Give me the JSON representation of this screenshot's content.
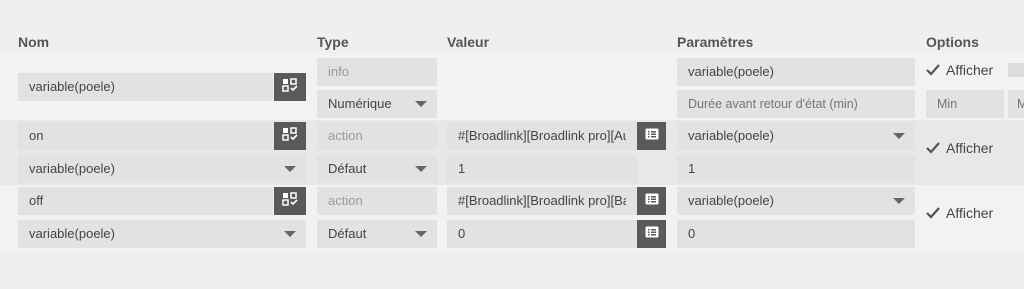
{
  "headers": {
    "nom": "Nom",
    "type": "Type",
    "valeur": "Valeur",
    "parametres": "Paramètres",
    "options": "Options"
  },
  "info_cmd": {
    "name": "variable(poele)",
    "type": "info",
    "subtype": "Numérique",
    "param_name": "variable(poele)",
    "return_delay_placeholder": "Durée avant retour d'état (min)",
    "min_placeholder": "Min",
    "max_placeholder_partial": "M",
    "show_label": "Afficher"
  },
  "on_cmd": {
    "name": "on",
    "type": "action",
    "value_cmd": "variable(poele)",
    "subtype": "Défaut",
    "valeur": "#[Broadlink][Broadlink pro][Augm",
    "valeur2": "1",
    "param_select": "variable(poele)",
    "param_value": "1",
    "show_label": "Afficher"
  },
  "off_cmd": {
    "name": "off",
    "type": "action",
    "value_cmd": "variable(poele)",
    "subtype": "Défaut",
    "valeur": "#[Broadlink][Broadlink pro][Baiss",
    "valeur2": "0",
    "param_select": "variable(poele)",
    "param_value": "0",
    "show_label": "Afficher"
  },
  "icons": {
    "configure": "configure-icon",
    "list": "list-icon",
    "check": "check-icon"
  }
}
